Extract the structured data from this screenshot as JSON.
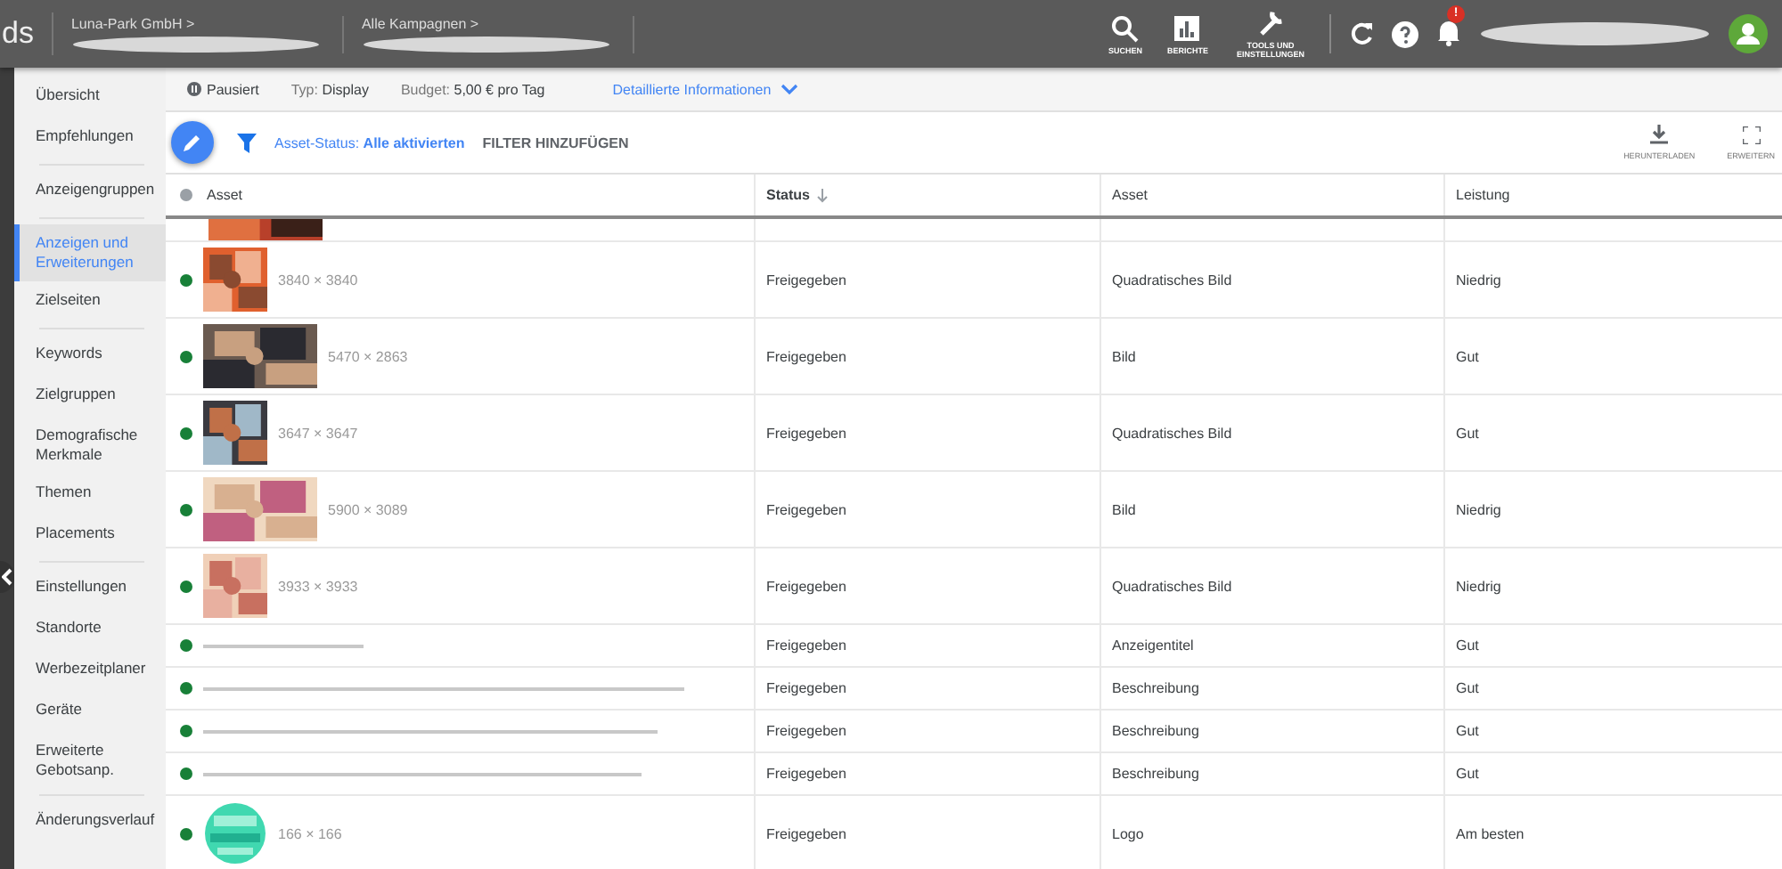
{
  "header": {
    "logo": "ds",
    "breadcrumbs": [
      {
        "label": "Luna-Park GmbH",
        "arrow": ">"
      },
      {
        "label": "Alle Kampagnen",
        "arrow": ">"
      }
    ],
    "tools": [
      {
        "kind": "search",
        "label": "SUCHEN"
      },
      {
        "kind": "reports",
        "label": "BERICHTE"
      },
      {
        "kind": "tools",
        "label": "TOOLS UND EINSTELLUNGEN"
      }
    ],
    "notification_badge": "!"
  },
  "sidebar": {
    "groups": [
      [
        {
          "label": "Übersicht",
          "selected": false
        },
        {
          "label": "Empfehlungen",
          "selected": false
        }
      ],
      [
        {
          "label": "Anzeigengruppen",
          "selected": false
        }
      ],
      [
        {
          "label": "Anzeigen und Erweiterungen",
          "selected": true
        },
        {
          "label": "Zielseiten",
          "selected": false
        }
      ],
      [
        {
          "label": "Keywords",
          "selected": false
        },
        {
          "label": "Zielgruppen",
          "selected": false
        },
        {
          "label": "Demografische Merkmale",
          "selected": false
        },
        {
          "label": "Themen",
          "selected": false
        },
        {
          "label": "Placements",
          "selected": false
        }
      ],
      [
        {
          "label": "Einstellungen",
          "selected": false
        },
        {
          "label": "Standorte",
          "selected": false
        },
        {
          "label": "Werbezeitplaner",
          "selected": false
        },
        {
          "label": "Geräte",
          "selected": false
        },
        {
          "label": "Erweiterte Gebotsanp.",
          "selected": false
        }
      ],
      [
        {
          "label": "Änderungsverlauf",
          "selected": false
        }
      ]
    ]
  },
  "campaign_bar": {
    "status": "Pausiert",
    "type_label": "Typ:",
    "type": "Display",
    "budget_label": "Budget:",
    "budget": "5,00 € pro Tag",
    "details_link": "Detaillierte Informationen"
  },
  "toolbar": {
    "filter_label": "Asset-Status:",
    "filter_value": "Alle aktivierten",
    "add_filter": "FILTER HINZUFÜGEN",
    "actions": [
      {
        "kind": "download",
        "label": "HERUNTERLADEN"
      },
      {
        "kind": "expand",
        "label": "ERWEITERN"
      }
    ]
  },
  "table": {
    "columns": [
      "Asset",
      "Status",
      "Asset",
      "Leistung"
    ],
    "rows": [
      {
        "kind": "partial"
      },
      {
        "size": "3840 × 3840",
        "status": "Freigegeben",
        "asset": "Quadratisches Bild",
        "performance": "Niedrig"
      },
      {
        "size": "5470 × 2863",
        "status": "Freigegeben",
        "asset": "Bild",
        "performance": "Gut"
      },
      {
        "size": "3647 × 3647",
        "status": "Freigegeben",
        "asset": "Quadratisches Bild",
        "performance": "Gut"
      },
      {
        "size": "5900 × 3089",
        "status": "Freigegeben",
        "asset": "Bild",
        "performance": "Niedrig"
      },
      {
        "size": "3933 × 3933",
        "status": "Freigegeben",
        "asset": "Quadratisches Bild",
        "performance": "Niedrig"
      },
      {
        "kind": "text",
        "status": "Freigegeben",
        "asset": "Anzeigentitel",
        "performance": "Gut"
      },
      {
        "kind": "text",
        "status": "Freigegeben",
        "asset": "Beschreibung",
        "performance": "Gut"
      },
      {
        "kind": "text",
        "status": "Freigegeben",
        "asset": "Beschreibung",
        "performance": "Gut"
      },
      {
        "kind": "text",
        "status": "Freigegeben",
        "asset": "Beschreibung",
        "performance": "Gut"
      },
      {
        "size": "166 × 166",
        "status": "Freigegeben",
        "asset": "Logo",
        "performance": "Am besten"
      }
    ]
  }
}
